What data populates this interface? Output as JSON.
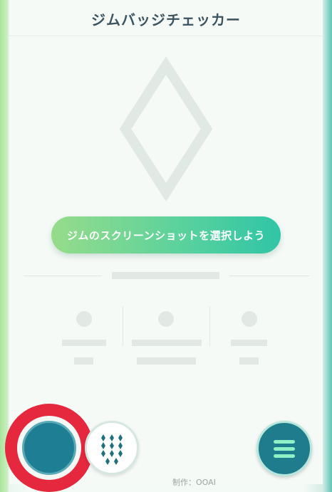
{
  "header": {
    "title": "ジムバッジチェッカー"
  },
  "main": {
    "select_button_label": "ジムのスクリーンショットを選択しよう"
  },
  "footer": {
    "credit": "制作：OOAI"
  },
  "icons": {
    "placeholder_badge": "diamond-outline-icon",
    "badges_grid": "diamond-grid-icon",
    "menu": "hamburger-icon"
  },
  "colors": {
    "accent_green": "#5cd29c",
    "teal": "#1f7c8c",
    "highlight_red": "#e5283e",
    "title_text": "#3b5460"
  }
}
